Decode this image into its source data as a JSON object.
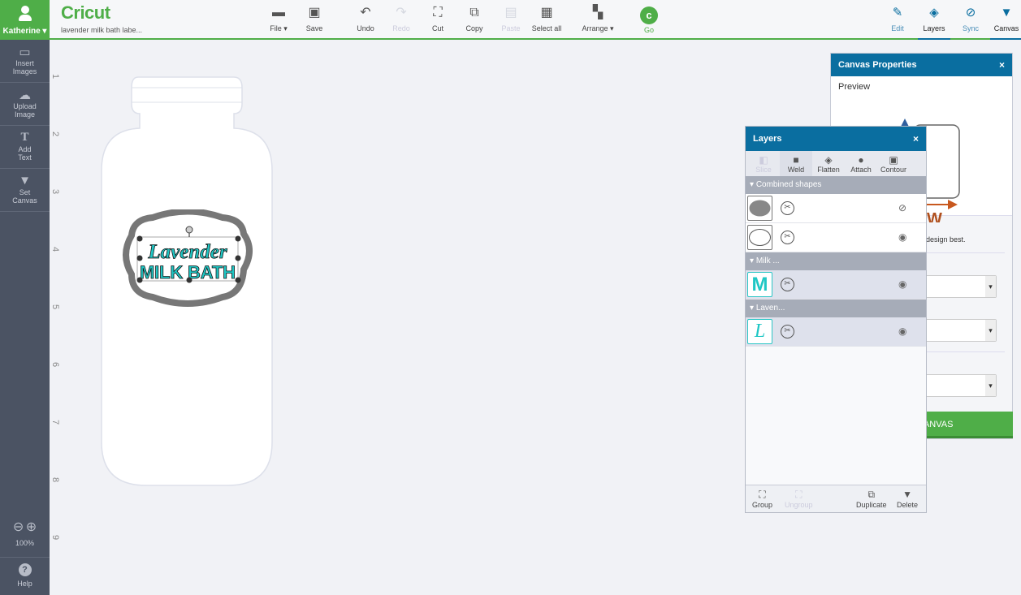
{
  "user": {
    "name": "Katherine"
  },
  "app": {
    "logo": "Cricut",
    "filename": "lavender milk bath labe..."
  },
  "toolbar": {
    "file": "File",
    "save": "Save",
    "undo": "Undo",
    "redo": "Redo",
    "cut": "Cut",
    "copy": "Copy",
    "paste": "Paste",
    "select_all": "Select all",
    "arrange": "Arrange",
    "go": "Go"
  },
  "right_tabs": {
    "edit": "Edit",
    "layers": "Layers",
    "sync": "Sync",
    "canvas": "Canvas"
  },
  "sidebar": {
    "items": [
      {
        "label": "Insert Images"
      },
      {
        "label": "Upload Image"
      },
      {
        "label": "Add Text"
      },
      {
        "label": "Set Canvas"
      }
    ],
    "zoom": "100%",
    "help": "Help"
  },
  "ruler": [
    "1",
    "2",
    "3",
    "4",
    "5",
    "6",
    "7",
    "8",
    "9"
  ],
  "design": {
    "line1": "Lavender",
    "line2": "MILK BATH"
  },
  "canvas_props": {
    "title": "Canvas Properties",
    "close": "×",
    "preview": "Preview",
    "hint": "design best.",
    "apply": "CANVAS",
    "w_mark": "W"
  },
  "layers": {
    "title": "Layers",
    "close": "×",
    "tools": [
      {
        "label": "Slice",
        "enabled": false
      },
      {
        "label": "Weld",
        "enabled": true
      },
      {
        "label": "Flatten",
        "enabled": true
      },
      {
        "label": "Attach",
        "enabled": true
      },
      {
        "label": "Contour",
        "enabled": true
      }
    ],
    "groups": [
      {
        "name": "Combined shapes"
      },
      {
        "name": "Milk ..."
      },
      {
        "name": "Laven..."
      }
    ],
    "thumbs": {
      "milk": "M",
      "laven": "L"
    },
    "footer": {
      "group": "Group",
      "ungroup": "Ungroup",
      "duplicate": "Duplicate",
      "delete": "Delete"
    }
  },
  "colors": {
    "brand_green": "#4fae48",
    "panel_blue": "#0a6ea0",
    "text_teal": "#1fc7c5",
    "sidebar": "#4b5363"
  }
}
